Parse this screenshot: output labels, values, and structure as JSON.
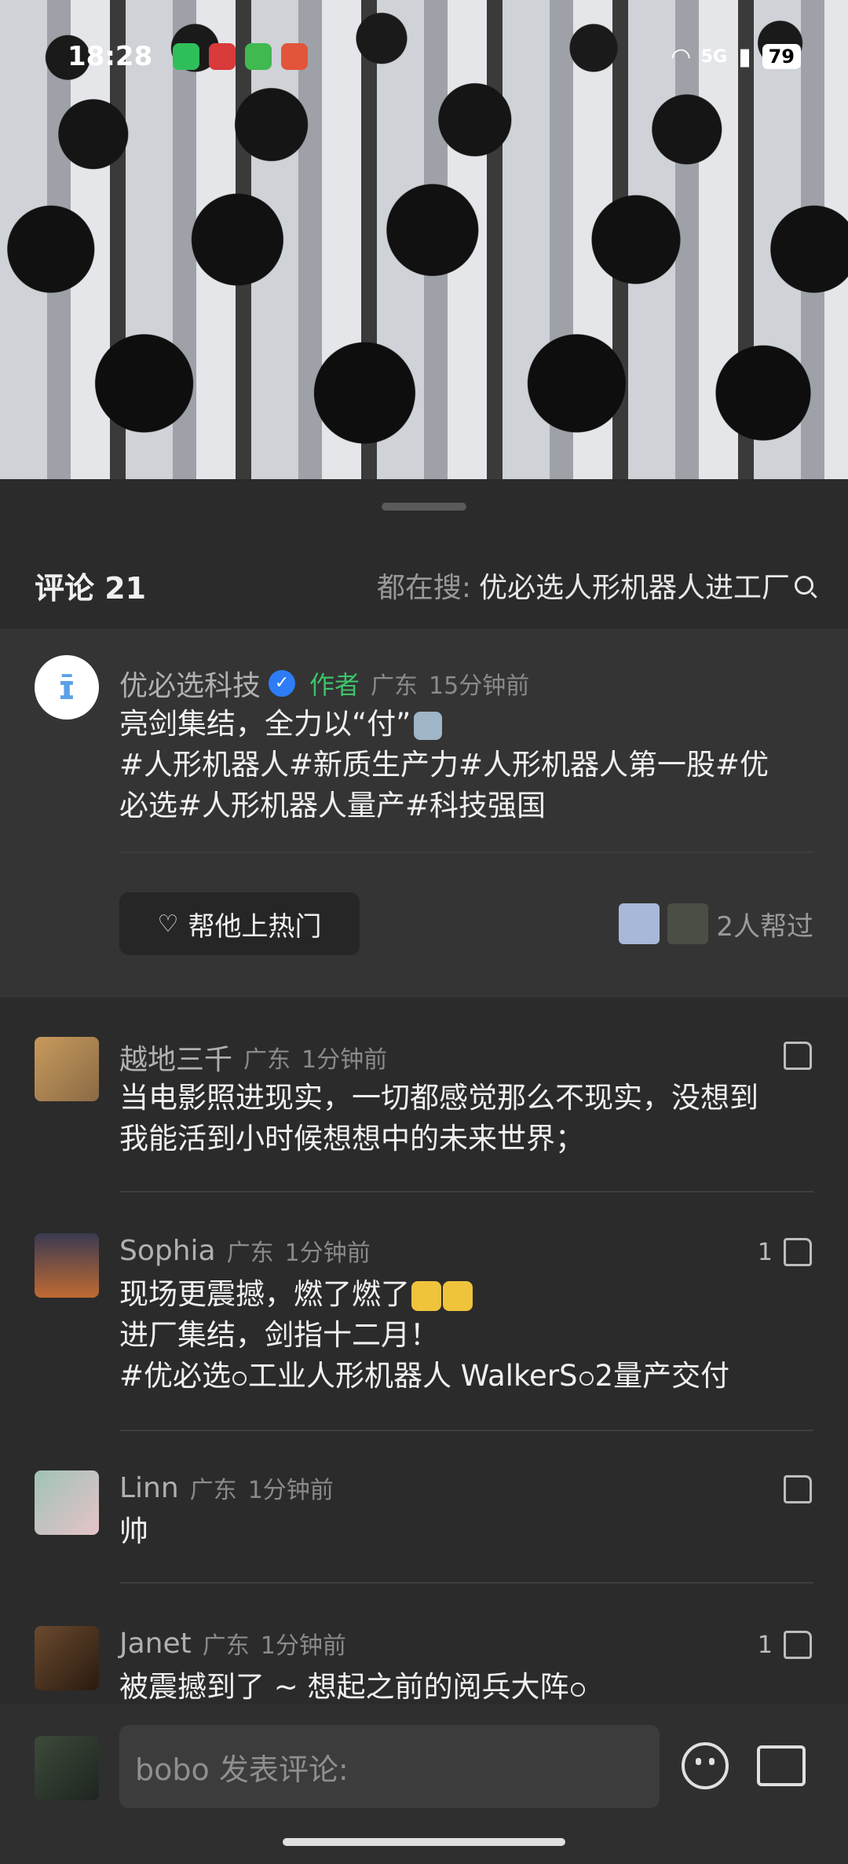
{
  "status_bar": {
    "time": "18:28",
    "battery": "79",
    "network": "5G"
  },
  "header": {
    "comment_count_label": "评论 21",
    "search_prefix": "都在搜:",
    "search_query": "优必选人形机器人进工厂"
  },
  "author_comment": {
    "name": "优必选科技",
    "tag": "作者",
    "location": "广东",
    "time": "15分钟前",
    "line1": "亮剑集结，全力以“付”",
    "line2": "#人形机器人#新质生产力#人形机器人第一股#优",
    "line3": "必选#人形机器人量产#科技强国",
    "boost_label": "帮他上热门",
    "helpers_label": "2人帮过"
  },
  "comments": [
    {
      "name": "越地三千",
      "location": "广东",
      "time": "1分钟前",
      "line1": "当电影照进现实，一切都感觉那么不现实，没想到",
      "line2": "我能活到小时候想想中的未来世界；",
      "line3": "",
      "likes": ""
    },
    {
      "name": "Sophia",
      "location": "广东",
      "time": "1分钟前",
      "line1": "现场更震撼，燃了燃了",
      "line2": "进厂集结，剑指十二月！",
      "line3a": "#优必选",
      "line3b": "工业人形机器人 WalkerS",
      "line3c": "2量产交付",
      "likes": "1"
    },
    {
      "name": "Linn",
      "location": "广东",
      "time": "1分钟前",
      "line1": "帅",
      "likes": ""
    },
    {
      "name": "Janet",
      "location": "广东",
      "time": "1分钟前",
      "line1": "被震撼到了 ~ 想起之前的阅兵大阵",
      "likes": "1"
    }
  ],
  "composer": {
    "placeholder": "bobo 发表评论:"
  }
}
